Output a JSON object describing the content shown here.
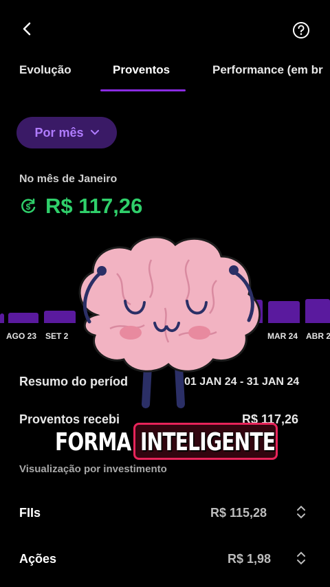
{
  "nav": {
    "back_icon": "chevron-left-icon",
    "help_icon": "question-circle-icon"
  },
  "tabs": [
    {
      "label": "Evolução",
      "active": false
    },
    {
      "label": "Proventos",
      "active": true
    },
    {
      "label": "Performance (em br",
      "active": false
    }
  ],
  "filter": {
    "label": "Por mês",
    "icon": "chevron-down-icon"
  },
  "summary": {
    "month_label": "No mês de Janeiro",
    "icon": "dollar-cycle-icon",
    "total": "R$ 117,26"
  },
  "chart_data": {
    "type": "bar",
    "categories": [
      "AGO 23",
      "SET 2",
      "MAR 24",
      "ABR 2"
    ],
    "values": [
      1,
      1.2,
      2.2,
      2.4
    ]
  },
  "period": {
    "title": "Resumo do períod",
    "range": "01 JAN 24 - 31 JAN 24"
  },
  "received": {
    "label": "Proventos recebi",
    "value": "R$ 117,26"
  },
  "view_label": "Visualização por investimento",
  "investments": [
    {
      "name": "FIIs",
      "value": "R$ 115,28"
    },
    {
      "name": "Ações",
      "value": "R$ 1,98"
    }
  ],
  "caption": {
    "word1": "FORMA",
    "word2": "INTELIGENTE"
  },
  "colors": {
    "accent": "#8a2be2",
    "positive": "#2fcf6a",
    "highlight": "#e8245a"
  }
}
